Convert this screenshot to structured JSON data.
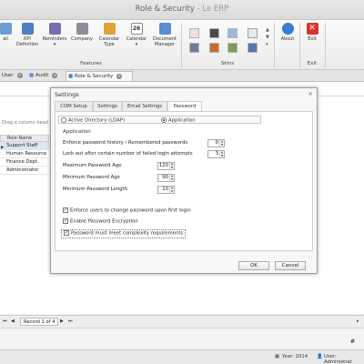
{
  "window": {
    "title": "Role & Security",
    "subtitle": " - Le ERP"
  },
  "ribbon": {
    "buttons": [
      {
        "label": "ail",
        "icon": "email-icon"
      },
      {
        "label": "KPI\nDefinition",
        "icon": "kpi-icon"
      },
      {
        "label": "Reminders\n▾",
        "icon": "bell-icon"
      },
      {
        "label": "Company",
        "icon": "company-icon"
      },
      {
        "label": "Calendar\nType",
        "icon": "calendar-type-icon"
      },
      {
        "label": "Calendar\n▾",
        "icon": "calendar-icon",
        "badge": "26"
      },
      {
        "label": "Document\nManager",
        "icon": "document-icon"
      },
      {
        "label": "About",
        "icon": "info-icon"
      },
      {
        "label": "Exit",
        "icon": "exit-icon"
      }
    ],
    "groups": {
      "features": "Features",
      "skins": "Skins",
      "exit": "Exit"
    }
  },
  "doctabs": [
    {
      "label": "User"
    },
    {
      "label": "Audit"
    },
    {
      "label": "Role & Security"
    }
  ],
  "grid": {
    "drag_hint": "Drag a column head",
    "column": "Role Name",
    "rows": [
      "Support Staff",
      "Human Resource",
      "Finance Dept.",
      "Administrator"
    ]
  },
  "record_nav": {
    "text": "Record 1 of 4"
  },
  "status": {
    "year": "Year: 2014",
    "user": "User: Administrat",
    "hash": "#"
  },
  "dialog": {
    "title": "Settings",
    "close": "×",
    "tabs": [
      "COM Setup",
      "Settings",
      "Email Settings",
      "Password"
    ],
    "active_tab": "Password",
    "auth_options": [
      "Active Directory (LDAP)",
      "Application"
    ],
    "section": "Application",
    "fields": [
      {
        "label": "Enforce password history / Remembered passwords",
        "value": "0"
      },
      {
        "label": "Lock out after certain number of failed login attempts",
        "value": "3"
      },
      {
        "label": "Maximum Password Age",
        "value": "120"
      },
      {
        "label": "Minimum Password Age",
        "value": "90"
      },
      {
        "label": "Minimum Password Length",
        "value": "10"
      }
    ],
    "checks": [
      {
        "label": "Enforce users to change password upon first login",
        "checked": true
      },
      {
        "label": "Enable Password Encryption",
        "checked": true
      },
      {
        "label": "Password must meet complexity requirements",
        "checked": true
      }
    ],
    "ok": "OK",
    "cancel": "Cancel"
  },
  "colors": {
    "accent": "#2f6db5",
    "selection": "#dde7f4",
    "exit_red": "#d9342b"
  }
}
